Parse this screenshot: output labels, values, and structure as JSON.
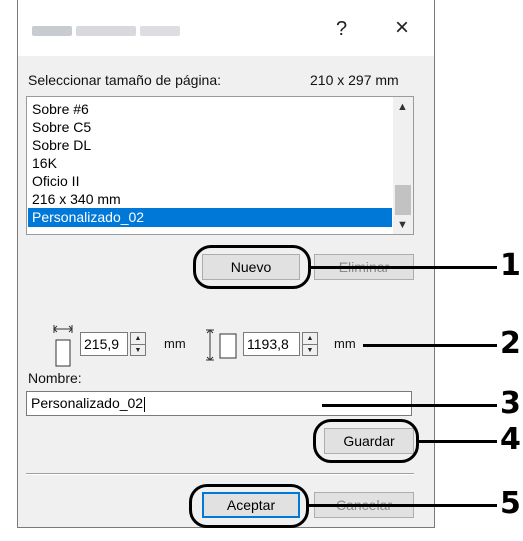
{
  "window": {
    "help_label": "?",
    "close_label": "×"
  },
  "page_size": {
    "label": "Seleccionar tamaño de página:",
    "current_size": "210 x 297 mm",
    "items": [
      "Sobre #6",
      "Sobre C5",
      "Sobre DL",
      "16K",
      "Oficio II",
      "216 x 340 mm",
      "Personalizado_02"
    ],
    "selected": "Personalizado_02"
  },
  "buttons": {
    "new": "Nuevo",
    "delete": "Eliminar",
    "save": "Guardar",
    "ok": "Aceptar",
    "cancel": "Cancelar"
  },
  "dimensions": {
    "width_value": "215,9",
    "width_unit": "mm",
    "height_value": "1193,8",
    "height_unit": "mm"
  },
  "name": {
    "label": "Nombre:",
    "value": "Personalizado_02"
  },
  "callouts": [
    "1",
    "2",
    "3",
    "4",
    "5"
  ]
}
